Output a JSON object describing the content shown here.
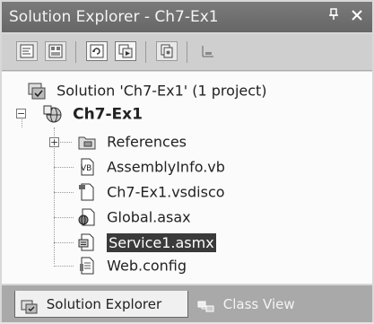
{
  "window": {
    "title": "Solution Explorer - Ch7-Ex1",
    "pin_icon": "pin-icon",
    "close_icon": "close-icon"
  },
  "toolbar": {
    "buttons": [
      {
        "icon": "view-code-icon"
      },
      {
        "icon": "view-designer-icon"
      },
      {
        "icon": "refresh-icon"
      },
      {
        "icon": "show-all-files-icon"
      },
      {
        "icon": "copy-project-icon"
      },
      {
        "icon": "properties-icon"
      }
    ]
  },
  "tree": {
    "solution": {
      "label": "Solution 'Ch7-Ex1' (1 project)",
      "icon": "solution-icon"
    },
    "project": {
      "label": "Ch7-Ex1",
      "icon": "web-project-icon",
      "expanded": true
    },
    "items": [
      {
        "label": "References",
        "icon": "references-folder-icon",
        "has_children": true
      },
      {
        "label": "AssemblyInfo.vb",
        "icon": "vb-file-icon"
      },
      {
        "label": "Ch7-Ex1.vsdisco",
        "icon": "disco-file-icon"
      },
      {
        "label": "Global.asax",
        "icon": "global-asax-icon"
      },
      {
        "label": "Service1.asmx",
        "icon": "asmx-file-icon",
        "selected": true
      },
      {
        "label": "Web.config",
        "icon": "config-file-icon"
      }
    ]
  },
  "tabs": [
    {
      "label": "Solution Explorer",
      "icon": "solution-explorer-icon",
      "active": true
    },
    {
      "label": "Class View",
      "icon": "class-view-icon",
      "active": false
    }
  ]
}
